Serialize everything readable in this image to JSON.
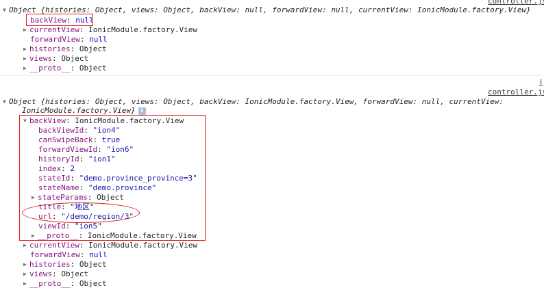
{
  "log1": {
    "file_link": "controller.js",
    "summary": {
      "prefix": "Object {",
      "k1": "histories",
      "v1": "Object",
      "k2": "views",
      "v2": "Object",
      "k3": "backView",
      "v3": "null",
      "k4": "forwardView",
      "v4": "null",
      "k5": "currentView",
      "v5": "IonicModule.factory.View",
      "suffix": "}"
    },
    "rows": [
      {
        "key": "backView",
        "value": "null"
      },
      {
        "key": "currentView",
        "value": "IonicModule.factory.View"
      },
      {
        "key": "forwardView",
        "value": "null"
      },
      {
        "key": "histories",
        "value": "Object"
      },
      {
        "key": "views",
        "value": "Object"
      },
      {
        "key": "__proto__",
        "value": "Object"
      }
    ]
  },
  "log2": {
    "file_link_top": "j",
    "file_link": "controller.js",
    "summary": {
      "prefix": "Object {",
      "k1": "histories",
      "v1": "Object",
      "k2": "views",
      "v2": "Object",
      "k3": "backView",
      "v3": "IonicModule.factory.View",
      "k4": "forwardView",
      "v4": "null",
      "k5": "currentView",
      "v5": "IonicModule.factory.View",
      "suffix": "}"
    },
    "info_icon": "i",
    "backView": {
      "key": "backView",
      "value": "IonicModule.factory.View",
      "children": [
        {
          "key": "backViewId",
          "value": "\"ion4\""
        },
        {
          "key": "canSwipeBack",
          "value": "true"
        },
        {
          "key": "forwardViewId",
          "value": "\"ion6\""
        },
        {
          "key": "historyId",
          "value": "\"ion1\""
        },
        {
          "key": "index",
          "value": "2"
        },
        {
          "key": "stateId",
          "value": "\"demo.province_province=3\""
        },
        {
          "key": "stateName",
          "value": "\"demo.province\""
        },
        {
          "key": "stateParams",
          "value": "Object"
        },
        {
          "key": "title",
          "value": "\"地区\""
        },
        {
          "key": "url",
          "value": "\"/demo/region/3\""
        },
        {
          "key": "viewId",
          "value": "\"ion5\""
        },
        {
          "key": "__proto__",
          "value": "IonicModule.factory.View"
        }
      ]
    },
    "rows": [
      {
        "key": "currentView",
        "value": "IonicModule.factory.View"
      },
      {
        "key": "forwardView",
        "value": "null"
      },
      {
        "key": "histories",
        "value": "Object"
      },
      {
        "key": "views",
        "value": "Object"
      },
      {
        "key": "__proto__",
        "value": "Object"
      }
    ]
  },
  "colors": {
    "key": "#881280",
    "string": "#1a1aa6",
    "number": "#1c00cf",
    "annotation": "#e02020"
  },
  "icons": [
    "expand-triangle-icon",
    "collapse-triangle-icon",
    "info-icon"
  ]
}
